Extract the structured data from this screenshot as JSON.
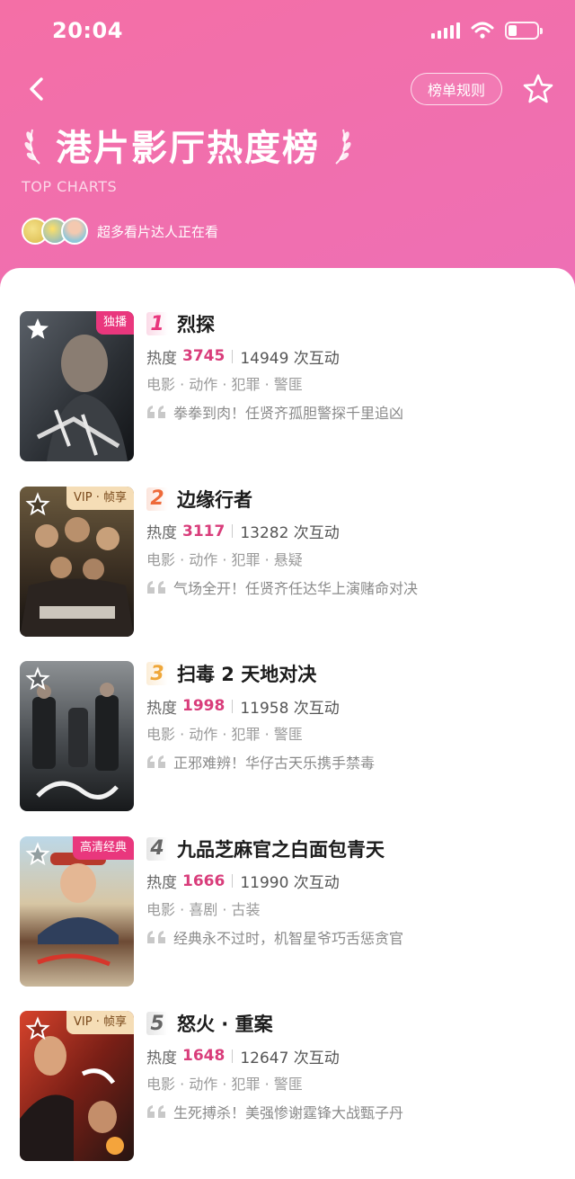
{
  "status_bar": {
    "time": "20:04"
  },
  "header": {
    "rules_label": "榜单规则",
    "title": "港片影厅热度榜",
    "subtitle": "TOP CHARTS",
    "watchers_text": "超多看片达人正在看"
  },
  "colors": {
    "accent": "#e9377d",
    "heat": "#d93d7b"
  },
  "items": [
    {
      "rank": "1",
      "title": "烈探",
      "badge": "独播",
      "heat_label": "热度",
      "heat": "3745",
      "interactions": "14949 次互动",
      "genres": "电影 · 动作 · 犯罪 · 警匪",
      "quote": "拳拳到肉！任贤齐孤胆警探千里追凶"
    },
    {
      "rank": "2",
      "title": "边缘行者",
      "badge": "VIP · 帧享",
      "heat_label": "热度",
      "heat": "3117",
      "interactions": "13282 次互动",
      "genres": "电影 · 动作 · 犯罪 · 悬疑",
      "quote": "气场全开！任贤齐任达华上演赌命对决"
    },
    {
      "rank": "3",
      "title": "扫毒 2 天地对决",
      "badge": "",
      "heat_label": "热度",
      "heat": "1998",
      "interactions": "11958 次互动",
      "genres": "电影 · 动作 · 犯罪 · 警匪",
      "quote": "正邪难辨！华仔古天乐携手禁毒"
    },
    {
      "rank": "4",
      "title": "九品芝麻官之白面包青天",
      "badge": "高清经典",
      "heat_label": "热度",
      "heat": "1666",
      "interactions": "11990 次互动",
      "genres": "电影 · 喜剧 · 古装",
      "quote": "经典永不过时，机智星爷巧舌惩贪官"
    },
    {
      "rank": "5",
      "title": "怒火 · 重案",
      "badge": "VIP · 帧享",
      "heat_label": "热度",
      "heat": "1648",
      "interactions": "12647 次互动",
      "genres": "电影 · 动作 · 犯罪 · 警匪",
      "quote": "生死搏杀！美强惨谢霆锋大战甄子丹"
    }
  ]
}
